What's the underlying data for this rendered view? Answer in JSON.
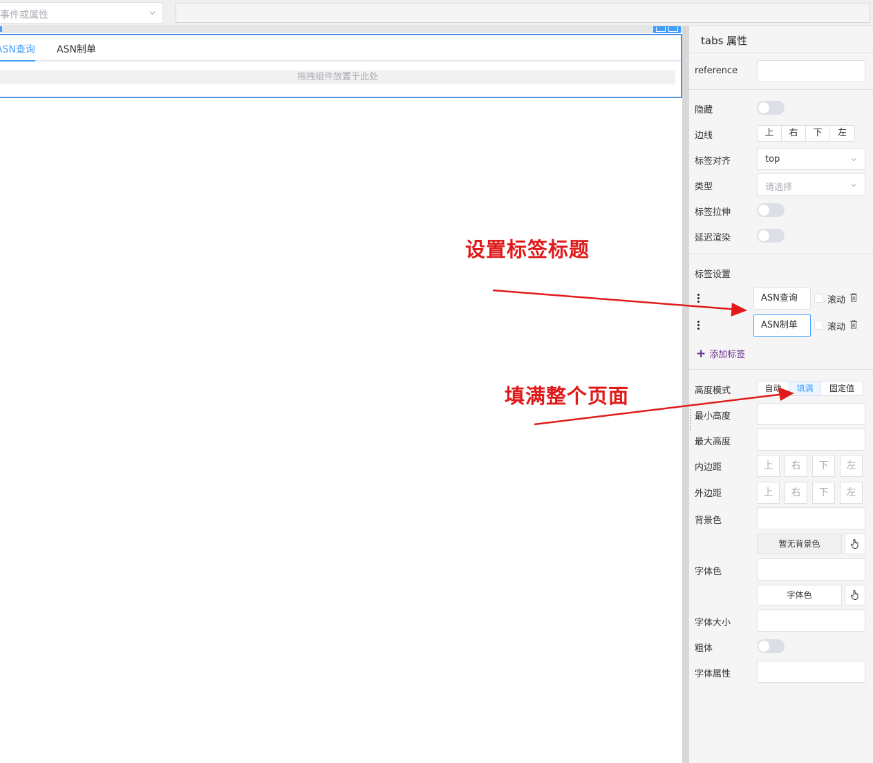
{
  "topbar": {
    "event_placeholder": "事件或属性"
  },
  "canvas": {
    "tabs": [
      {
        "label": "ASN查询"
      },
      {
        "label": "ASN制单"
      }
    ],
    "drop_hint": "拖拽组件放置于此处"
  },
  "panel": {
    "title": "tabs 属性",
    "reference_label": "reference",
    "hidden_label": "隐藏",
    "border_label": "边线",
    "sides": [
      "上",
      "右",
      "下",
      "左"
    ],
    "tab_align_label": "标签对齐",
    "tab_align_value": "top",
    "type_label": "类型",
    "type_placeholder": "请选择",
    "stretch_label": "标签拉伸",
    "lazy_label": "延迟渲染",
    "tab_settings_label": "标签设置",
    "tab_items": [
      {
        "title": "ASN查询",
        "scroll_label": "滚动"
      },
      {
        "title": "ASN制单",
        "scroll_label": "滚动"
      }
    ],
    "add_tab_label": "添加标签",
    "height_mode_label": "高度模式",
    "height_modes": [
      "自动",
      "填满",
      "固定值"
    ],
    "height_mode_selected": "填满",
    "min_height_label": "最小高度",
    "max_height_label": "最大高度",
    "padding_label": "内边距",
    "margin_label": "外边距",
    "bg_color_label": "背景色",
    "bg_color_button": "暂无背景色",
    "font_color_label": "字体色",
    "font_color_button": "字体色",
    "font_size_label": "字体大小",
    "bold_label": "粗体",
    "font_attr_label": "字体属性"
  },
  "annotations": {
    "tab_title_note": "设置标签标题",
    "fill_page_note": "填满整个页面"
  },
  "colors": {
    "accent": "#409eff",
    "annotation": "#e01a1a",
    "add_link": "#6b2f8f"
  }
}
